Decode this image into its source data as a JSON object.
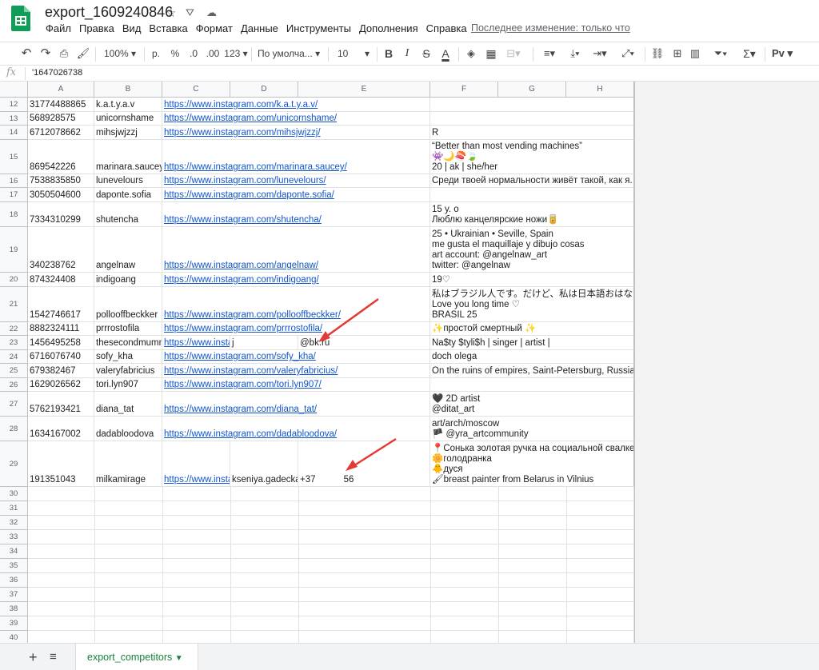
{
  "doc": {
    "title": "export_1609240846",
    "star_icon": "star-icon",
    "move_icon": "drive-move-icon",
    "cloud_icon": "cloud-status-icon",
    "last_edit": "Последнее изменение: только что"
  },
  "menu": [
    "Файл",
    "Правка",
    "Вид",
    "Вставка",
    "Формат",
    "Данные",
    "Инструменты",
    "Дополнения",
    "Справка"
  ],
  "toolbar": {
    "zoom": "100%",
    "currency": "р.",
    "percent": "%",
    "dec_decrease": ".0",
    "dec_increase": ".00",
    "format_more": "123",
    "font": "По умолча...",
    "font_size": "10",
    "bold": "B",
    "italic": "I",
    "strike": "S",
    "text_color": "A",
    "input_tool": "Pv"
  },
  "formula_bar": {
    "fx": "fx",
    "value": "'1647026738"
  },
  "columns": [
    "A",
    "B",
    "C",
    "D",
    "E",
    "F",
    "G",
    "H"
  ],
  "rows": [
    {
      "num": "12",
      "a": "31774488865",
      "b": "k.a.t.y.a.v",
      "c": "https://www.instagram.com/k.a.t.y.a.v/",
      "f": ""
    },
    {
      "num": "13",
      "a": "568928575",
      "b": "unicornshame",
      "c": "https://www.instagram.com/unicornshame/",
      "f": ""
    },
    {
      "num": "14",
      "a": "6712078662",
      "b": "mihsjwjzzj",
      "c": "https://www.instagram.com/mihsjwjzzj/",
      "f": "R"
    },
    {
      "num": "15",
      "a": "869542226",
      "b": "marinara.saucey",
      "c": "https://www.instagram.com/marinara.saucey/",
      "f": "“Better than most vending machines”\n👾🌙🍣🍃\n20 | ak | she/her"
    },
    {
      "num": "16",
      "a": "7538835850",
      "b": "lunevelours",
      "c": "https://www.instagram.com/lunevelours/",
      "f": "Среди твоей нормальности живёт такой, как я."
    },
    {
      "num": "17",
      "a": "3050504600",
      "b": "daponte.sofia",
      "c": "https://www.instagram.com/daponte.sofia/",
      "f": ""
    },
    {
      "num": "18",
      "a": "7334310299",
      "b": "shutencha",
      "c": "https://www.instagram.com/shutencha/",
      "f": "15 y. o\nЛюблю канцелярские ножи🥫"
    },
    {
      "num": "19",
      "a": "340238762",
      "b": "angelnaw",
      "c": "https://www.instagram.com/angelnaw/",
      "f": "25 • Ukrainian • Seville, Spain\nme gusta el maquillaje y dibujo cosas\nart account: @angelnaw_art\ntwitter: @angelnaw"
    },
    {
      "num": "20",
      "a": "874324408",
      "b": "indigoang",
      "c": "https://www.instagram.com/indigoang/",
      "f": "19♡"
    },
    {
      "num": "21",
      "a": "1542746617",
      "b": "pollooffbeckker",
      "c": "https://www.instagram.com/pollooffbeckker/",
      "f": "私はブラジル人です。だけど、私は日本語おはな\nLove you long time ♡\nBRASIL 25"
    },
    {
      "num": "22",
      "a": "8882324111",
      "b": "prrrostofila",
      "c": "https://www.instagram.com/prrrostofila/",
      "f": "✨простой смертный ✨"
    },
    {
      "num": "23",
      "a": "1456495258",
      "b": "thesecondmumm",
      "c": "https://www.insta",
      "d": "j",
      "e": "@bk.ru",
      "f": "Na$ty $tyli$h | singer | artist |"
    },
    {
      "num": "24",
      "a": "6716076740",
      "b": "sofy_kha",
      "c": "https://www.instagram.com/sofy_kha/",
      "f": "doch olega"
    },
    {
      "num": "25",
      "a": "679382467",
      "b": "valeryfabricius",
      "c": "https://www.instagram.com/valeryfabricius/",
      "f": "On the ruins of empires, Saint-Petersburg, Russia"
    },
    {
      "num": "26",
      "a": "1629026562",
      "b": "tori.lyn907",
      "c": "https://www.instagram.com/tori.lyn907/",
      "f": ""
    },
    {
      "num": "27",
      "a": "5762193421",
      "b": "diana_tat",
      "c": "https://www.instagram.com/diana_tat/",
      "f": "🖤 2D artist\n@ditat_art"
    },
    {
      "num": "28",
      "a": "1634167002",
      "b": "dadabloodova",
      "c": "https://www.instagram.com/dadabloodova/",
      "f": "art/arch/moscow\n🏴 @yra_artcommunity"
    },
    {
      "num": "29",
      "a": "191351043",
      "b": "milkamirage",
      "c": "https://www.insta",
      "d": "kseniya.gadecka",
      "e": "+37           56",
      "f": "📍Сонька золотая ручка на социальной свалке\n🌼голодранка\n🐥дуся\n🖌breast painter from Belarus in Vilnius"
    },
    {
      "num": "30"
    },
    {
      "num": "31"
    },
    {
      "num": "32"
    },
    {
      "num": "33"
    },
    {
      "num": "34"
    },
    {
      "num": "35"
    },
    {
      "num": "36"
    },
    {
      "num": "37"
    },
    {
      "num": "38"
    },
    {
      "num": "39"
    },
    {
      "num": "40"
    }
  ],
  "sheet_tab": "export_competitors",
  "colors": {
    "link": "#1155cc",
    "tab_green": "#188038",
    "arrow": "#e53935",
    "sheets_green": "#0f9d58"
  }
}
